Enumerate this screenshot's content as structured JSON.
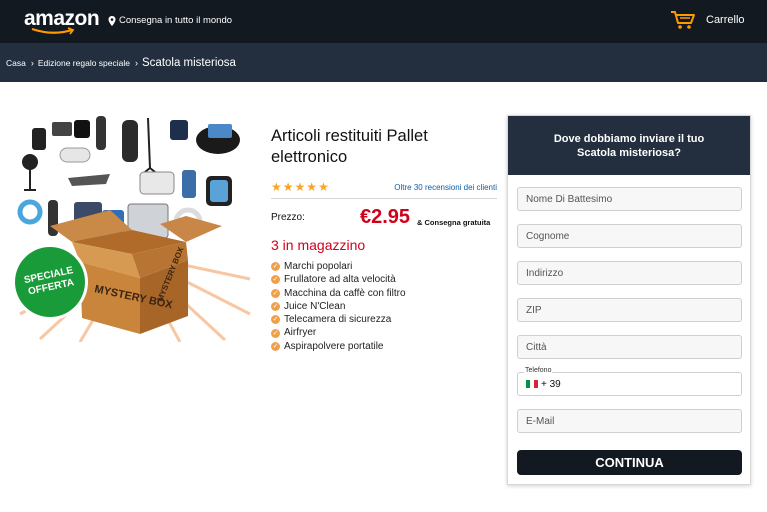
{
  "header": {
    "logo_text": "amazon",
    "shipping_text": "Consegna in tutto il mondo",
    "cart_label": "Carrello"
  },
  "breadcrumb": {
    "items": [
      "Casa",
      "Edizione regalo speciale"
    ],
    "current": "Scatola misteriosa"
  },
  "product": {
    "image_badge": "SPECIALE OFFERTA",
    "box_text_front": "MYSTERY BOX",
    "box_text_side": "MYSTERY BOX",
    "title": "Articoli restituiti Pallet elettronico",
    "rating_stars": 5,
    "reviews_link": "Oltre 30 recensioni dei clienti",
    "price_label": "Prezzo:",
    "price": "€2.95",
    "delivery": "& Consegna gratuita",
    "stock": "3 in magazzino",
    "features": [
      "Marchi popolari",
      "Frullatore ad alta velocità",
      "Macchina da caffè con filtro",
      "Juice N'Clean",
      "Telecamera di sicurezza",
      "Airfryer",
      "Aspirapolvere portatile"
    ]
  },
  "form": {
    "heading": "Dove dobbiamo inviare il tuo Scatola misteriosa?",
    "first_name_placeholder": "Nome Di Battesimo",
    "last_name_placeholder": "Cognome",
    "address_placeholder": "Indirizzo",
    "zip_placeholder": "ZIP",
    "city_placeholder": "Città",
    "phone_label": "Telefono",
    "phone_prefix": "+ 39",
    "email_placeholder": "E-Mail",
    "submit_label": "CONTINUA"
  },
  "colors": {
    "header_bg": "#131921",
    "subheader_bg": "#232f3e",
    "price_red": "#d0021b",
    "star_orange": "#f5a623",
    "badge_green": "#1a9b3a",
    "link_blue": "#0a5ea8"
  },
  "icons": {
    "pin": "location-pin-icon",
    "cart": "cart-icon",
    "bullet": "check-circle-icon",
    "flag": "italy-flag-icon"
  }
}
